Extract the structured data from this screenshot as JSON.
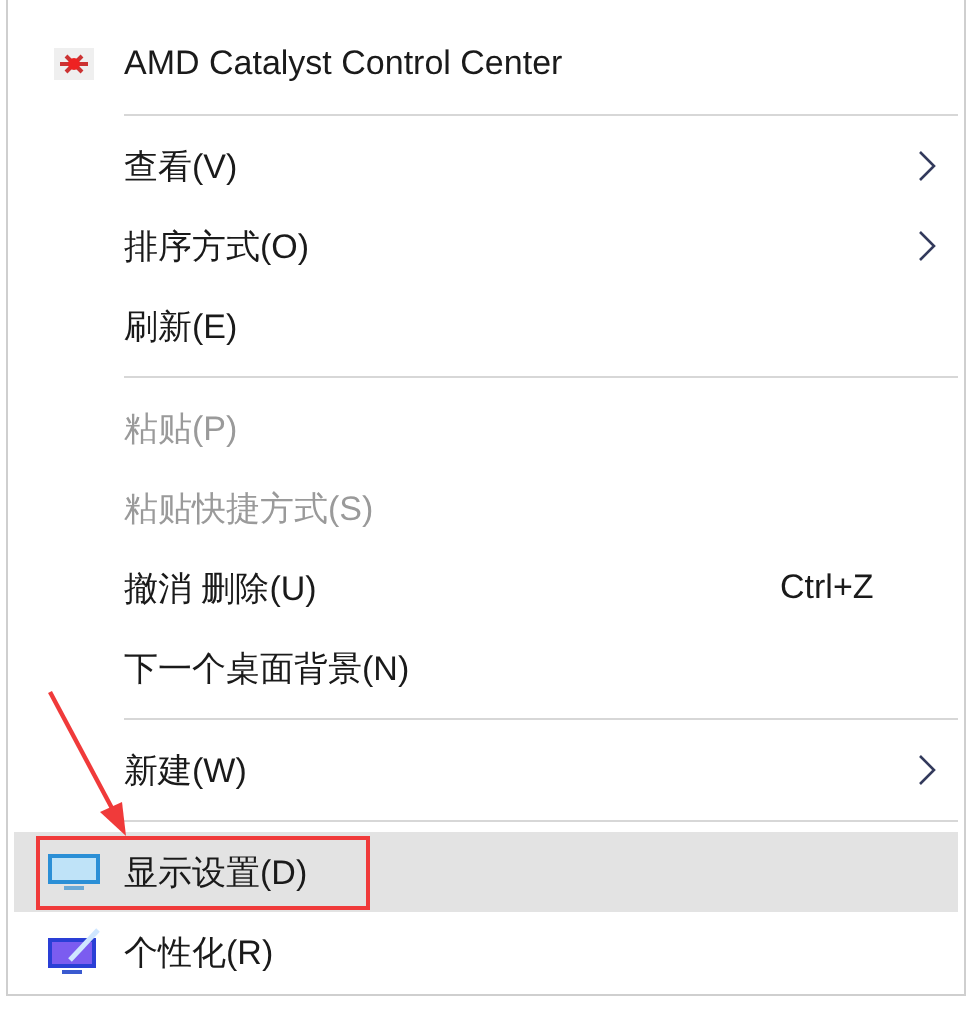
{
  "menu": {
    "groups": [
      {
        "items": [
          {
            "label": "AMD Catalyst Control Center",
            "disabled": false,
            "submenu": false,
            "selected": false,
            "annotated": false
          }
        ]
      },
      {
        "items": [
          {
            "label": "查看(V)",
            "disabled": false,
            "submenu": true,
            "selected": false,
            "annotated": false
          },
          {
            "label": "排序方式(O)",
            "disabled": false,
            "submenu": true,
            "selected": false,
            "annotated": false
          },
          {
            "label": "刷新(E)",
            "disabled": false,
            "submenu": false,
            "selected": false,
            "annotated": false
          }
        ]
      },
      {
        "items": [
          {
            "label": "粘贴(P)",
            "disabled": true,
            "submenu": false,
            "selected": false,
            "annotated": false
          },
          {
            "label": "粘贴快捷方式(S)",
            "disabled": true,
            "submenu": false,
            "selected": false,
            "annotated": false
          },
          {
            "label": "撤消 删除(U)",
            "shortcut": "Ctrl+Z",
            "disabled": false,
            "submenu": false,
            "selected": false,
            "annotated": false
          },
          {
            "label": "下一个桌面背景(N)",
            "disabled": false,
            "submenu": false,
            "selected": false,
            "annotated": false
          }
        ]
      },
      {
        "items": [
          {
            "label": "新建(W)",
            "disabled": false,
            "submenu": true,
            "selected": false,
            "annotated": false
          }
        ]
      },
      {
        "items": [
          {
            "label": "显示设置(D)",
            "disabled": false,
            "submenu": false,
            "selected": true,
            "annotated": true
          },
          {
            "label": "个性化(R)",
            "disabled": false,
            "submenu": false,
            "selected": false,
            "annotated": false
          }
        ]
      }
    ]
  }
}
